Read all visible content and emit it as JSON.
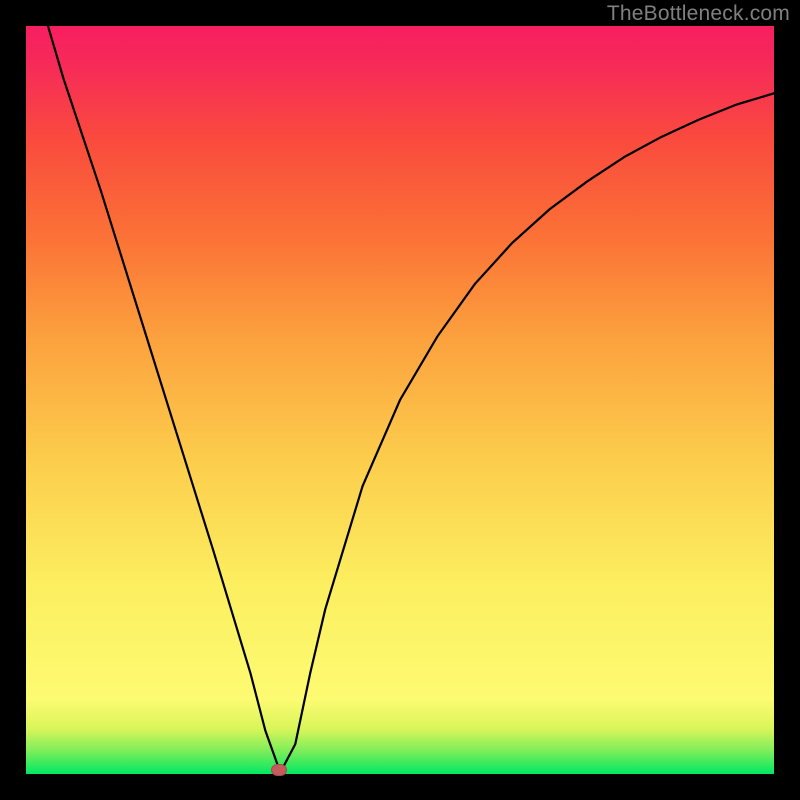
{
  "attribution": "TheBottleneck.com",
  "colors": {
    "frame": "#000000",
    "curve": "#000000",
    "marker": "#c75a5a",
    "gradient_top": "#f71e61",
    "gradient_mid_upper": "#fb7136",
    "gradient_mid": "#fcef60",
    "gradient_lower": "#d8f559",
    "gradient_bottom": "#00e862"
  },
  "chart_data": {
    "type": "line",
    "title": "",
    "xlabel": "",
    "ylabel": "",
    "xlim": [
      0,
      10
    ],
    "ylim": [
      0,
      10
    ],
    "x": [
      0.0,
      0.5,
      1.0,
      1.5,
      2.0,
      2.5,
      3.0,
      3.2,
      3.4,
      3.6,
      3.8,
      4.0,
      4.5,
      5.0,
      5.5,
      6.0,
      6.5,
      7.0,
      7.5,
      8.0,
      8.5,
      9.0,
      9.5,
      10.0
    ],
    "values": [
      11.0,
      9.3,
      7.8,
      6.2,
      4.6,
      3.0,
      1.35,
      0.58,
      0.02,
      0.4,
      1.35,
      2.2,
      3.85,
      5.0,
      5.85,
      6.55,
      7.1,
      7.55,
      7.92,
      8.25,
      8.52,
      8.75,
      8.95,
      9.1
    ],
    "annotations": [
      {
        "type": "marker",
        "x": 3.38,
        "y": 0.05,
        "shape": "ellipse",
        "color": "#c75a5a"
      }
    ]
  }
}
